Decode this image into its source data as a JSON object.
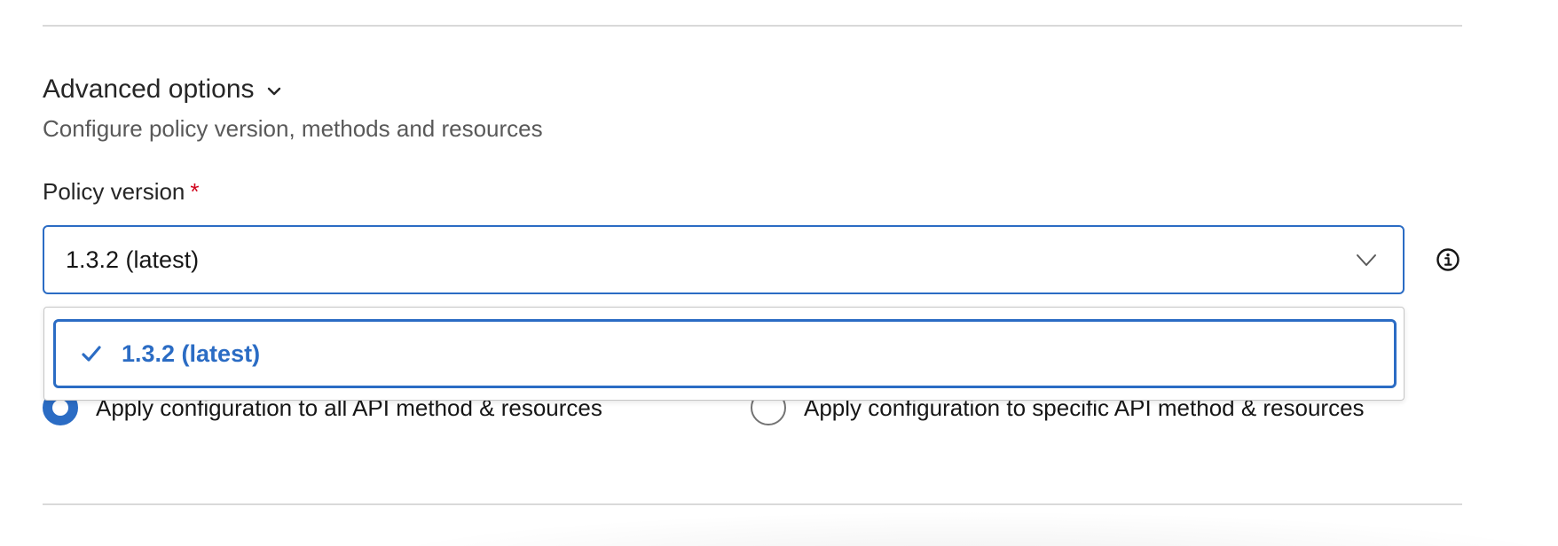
{
  "section": {
    "title": "Advanced options",
    "subtitle": "Configure policy version, methods and resources",
    "expand_icon": "chevron-down-icon"
  },
  "policy_version": {
    "label": "Policy version",
    "required_marker": "*",
    "selected_value": "1.3.2 (latest)",
    "info_icon": "info-icon",
    "options": [
      {
        "label": "1.3.2 (latest)",
        "selected": true
      }
    ]
  },
  "apply_config": {
    "options": [
      {
        "label": "Apply configuration to all API method & resources",
        "checked": true
      },
      {
        "label": "Apply configuration to specific API method & resources",
        "checked": false
      }
    ]
  },
  "colors": {
    "accent": "#2b6cc4",
    "required": "#d0021b",
    "divider": "#d9d9d9",
    "text_primary": "#262626",
    "text_secondary": "#595959"
  }
}
